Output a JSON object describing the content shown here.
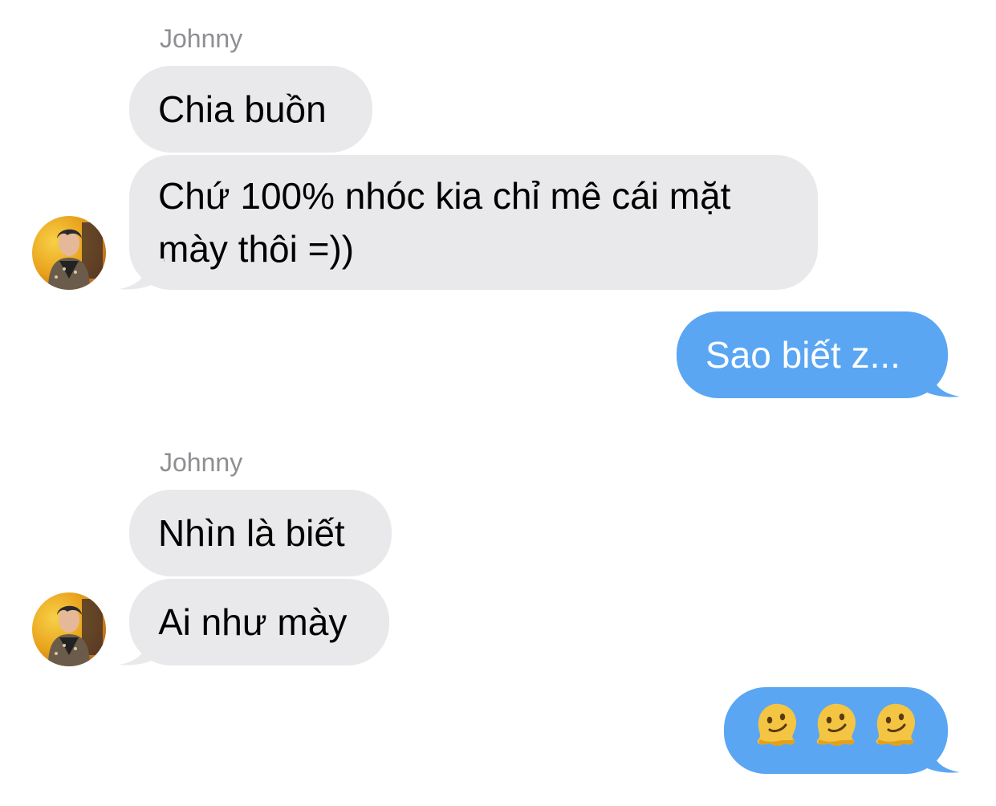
{
  "colors": {
    "incoming_bubble": "#e9e9eb",
    "outgoing_bubble": "#5aa6f3",
    "sender_name": "#8e8e93"
  },
  "groups": [
    {
      "sender": "Johnny",
      "messages": [
        "Chia buồn",
        "Chứ 100% nhóc kia chỉ mê cái mặt mày thôi =))"
      ]
    },
    {
      "sender": "Johnny",
      "messages": [
        "Nhìn là biết",
        "Ai như mày"
      ]
    }
  ],
  "outgoing": [
    "Sao biết z...",
    "🫠🫠🫠"
  ],
  "icons": {
    "avatar": "avatar-photo",
    "emoji": "melting-face-emoji"
  }
}
